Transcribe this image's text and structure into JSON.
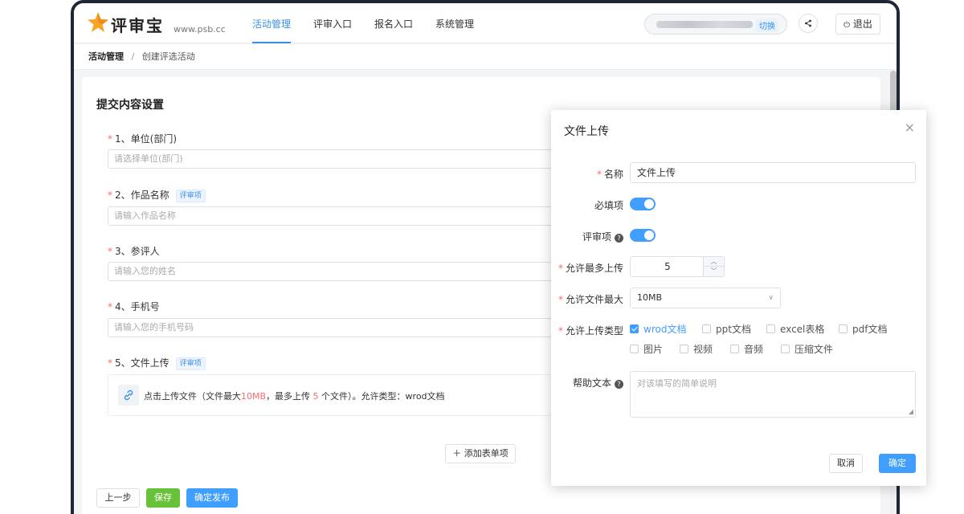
{
  "header": {
    "logo_text": "评审宝",
    "logo_url": "www.psb.cc",
    "nav": [
      "活动管理",
      "评审入口",
      "报名入口",
      "系统管理"
    ],
    "switch_label": "切换",
    "logout_label": "退出",
    "share_icon": "share-icon",
    "power_icon": "power-icon"
  },
  "breadcrumb": {
    "root": "活动管理",
    "separator": "/",
    "current": "创建评选活动"
  },
  "form": {
    "title": "提交内容设置",
    "fields": [
      {
        "label": "1、单位(部门)",
        "placeholder": "请选择单位(部门)",
        "tag": ""
      },
      {
        "label": "2、作品名称",
        "placeholder": "请输入作品名称",
        "tag": "评审项"
      },
      {
        "label": "3、参评人",
        "placeholder": "请输入您的姓名",
        "tag": ""
      },
      {
        "label": "4、手机号",
        "placeholder": "请输入您的手机号码",
        "tag": ""
      },
      {
        "label": "5、文件上传",
        "placeholder": "",
        "tag": "评审项"
      }
    ],
    "required_mark": "*",
    "upload": {
      "prefix": "点击上传文件（文件最大",
      "max_size": "10MB",
      "middle": "，最多上传",
      "max_count": "5",
      "suffix": "个文件）。允许类型：wrod文档"
    },
    "add_item_label": "添加表单项",
    "prev_label": "上一步",
    "save_label": "保存",
    "publish_label": "确定发布"
  },
  "dialog": {
    "title": "文件上传",
    "name_label": "名称",
    "name_value": "文件上传",
    "required_label": "必填项",
    "review_label": "评审项",
    "max_upload_label": "允许最多上传",
    "max_upload_value": "5",
    "max_size_label": "允许文件最大",
    "max_size_value": "10MB",
    "types_label": "允许上传类型",
    "types": [
      {
        "label": "wrod文档",
        "checked": true
      },
      {
        "label": "ppt文档",
        "checked": false
      },
      {
        "label": "excel表格",
        "checked": false
      },
      {
        "label": "pdf文档",
        "checked": false
      },
      {
        "label": "图片",
        "checked": false
      },
      {
        "label": "视频",
        "checked": false
      },
      {
        "label": "音频",
        "checked": false
      },
      {
        "label": "压缩文件",
        "checked": false
      }
    ],
    "help_label": "帮助文本",
    "help_placeholder": "对该填写的简单说明",
    "cancel_label": "取消",
    "ok_label": "确定",
    "required_toggle_on": true,
    "review_toggle_on": true
  },
  "colors": {
    "accent": "#409eff",
    "save": "#67c23a",
    "required": "#f56c6c"
  }
}
